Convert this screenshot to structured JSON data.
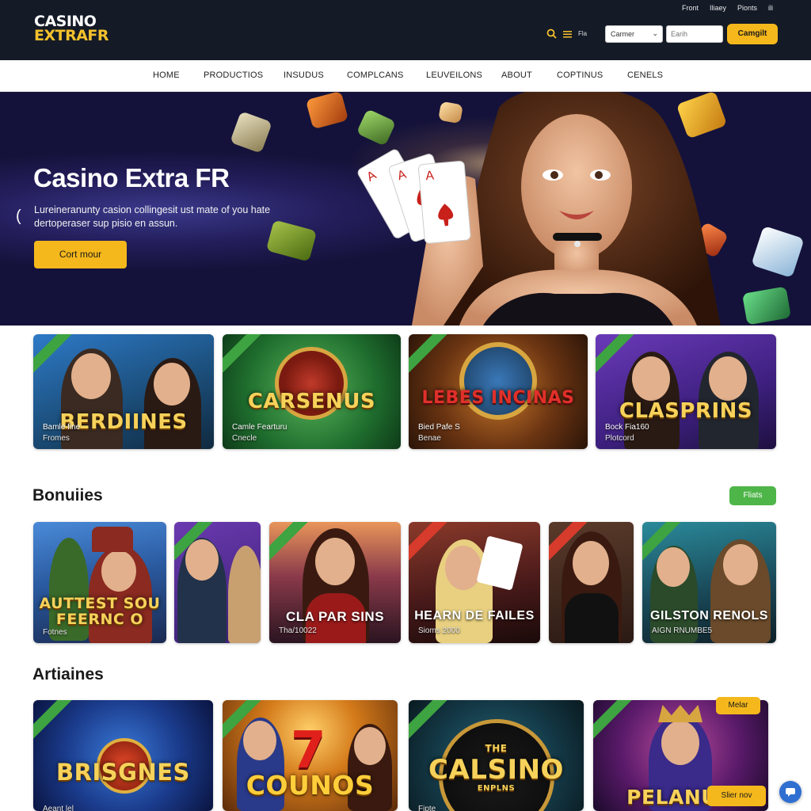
{
  "header": {
    "logo_line1": "CASINO",
    "logo_line2": "EXTRAFR",
    "top_links": [
      "Front",
      "Iliaey",
      "Pionts",
      "ili"
    ],
    "lang_label": "Fla",
    "select_value": "Carmer",
    "search_placeholder": "Earih",
    "cta_label": "Camgilt"
  },
  "nav": {
    "items": [
      "HOME",
      "PRODUCTIOS",
      "INSUDUS",
      "COMPLCANS",
      "LEUVEILONS",
      "ABOUT",
      "COPTINUS",
      "CENELS"
    ]
  },
  "hero": {
    "title": "Casino Extra FR",
    "subtitle": "Lureineranunty casion collingesit ust mate of you hate dertoperaser sup pisio en assun.",
    "cta_label": "Cort mour"
  },
  "featured": [
    {
      "big": "BERDIINES",
      "cap1": "Bamle fine",
      "cap2": "Fromes"
    },
    {
      "big": "CARSENUS",
      "cap1": "Camle Fearturu",
      "cap2": "Cnecle"
    },
    {
      "big": "LEBES INCINAS",
      "cap1": "Bied Pafe S",
      "cap2": "Benae"
    },
    {
      "big": "CLASPRINS",
      "cap1": "Bock Fia160",
      "cap2": "Plotcord"
    }
  ],
  "bonuses": {
    "title": "Bonuiies",
    "pill": "Fliats",
    "cards": [
      {
        "big1": "AUTTEST SOU",
        "big2": "FEERNC O",
        "cap": "Fotnes"
      },
      {
        "big1": "",
        "big2": "",
        "cap": ""
      },
      {
        "big1": "CLA PAR SINS",
        "big2": "",
        "cap": "Tha/10022"
      },
      {
        "big1": "HEARN DE FAILES",
        "big2": "",
        "cap": "Sioms 2000"
      },
      {
        "big1": "",
        "big2": "",
        "cap": ""
      },
      {
        "big1": "GILSTON RENOLS",
        "big2": "",
        "cap": "AIGN RNUMBE5"
      }
    ]
  },
  "artiaines": {
    "title": "Artiaines",
    "cards": [
      {
        "big": "BRISGNES",
        "cap": "Aeant lel"
      },
      {
        "big": "COUNOS",
        "cap": ""
      },
      {
        "big": "CALSINO",
        "sub": "ENPLNS",
        "top": "THE",
        "cap": "Fipte"
      },
      {
        "big": "PELANUO",
        "badge": "Melar",
        "cta": "Slier nov",
        "cap": ""
      }
    ]
  },
  "colors": {
    "header_bg": "#141a26",
    "accent_yellow": "#f5b81c",
    "accent_green": "#4eb548",
    "chat_blue": "#2e6fd1"
  }
}
